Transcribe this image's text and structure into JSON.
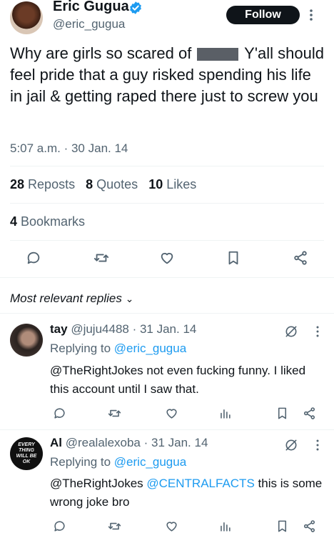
{
  "tweet": {
    "author_name": "Eric Gugua",
    "author_handle": "@eric_gugua",
    "follow_label": "Follow",
    "text_before": "Why are girls so scared of",
    "text_after": "Y'all should feel pride that a guy risked spending his life in jail & getting raped there just to screw you",
    "timestamp": "5:07 a.m. · 30 Jan. 14",
    "reposts_count": "28",
    "reposts_label": "Reposts",
    "quotes_count": "8",
    "quotes_label": "Quotes",
    "likes_count": "10",
    "likes_label": "Likes",
    "bookmarks_count": "4",
    "bookmarks_label": "Bookmarks"
  },
  "replies_header": "Most relevant replies",
  "replies": [
    {
      "name": "tay",
      "meta": "@juju4488 · 31 Jan. 14",
      "replying_prefix": "Replying to",
      "replying_to": "@eric_gugua",
      "text": "@TheRightJokes not even fucking funny. I liked this account until I saw that."
    },
    {
      "name": "Al",
      "meta": "@realalexoba · 31 Jan. 14",
      "replying_prefix": "Replying to",
      "replying_to": "@eric_gugua",
      "mention_1": "@TheRightJokes",
      "mention_2": "@CENTRALFACTS",
      "text_rest": "this is some wrong joke bro",
      "avatar_text": "EVERY THING WILL BE OK"
    }
  ],
  "colors": {
    "accent": "#1d9bf0",
    "text": "#0f1419",
    "secondary": "#536471"
  }
}
